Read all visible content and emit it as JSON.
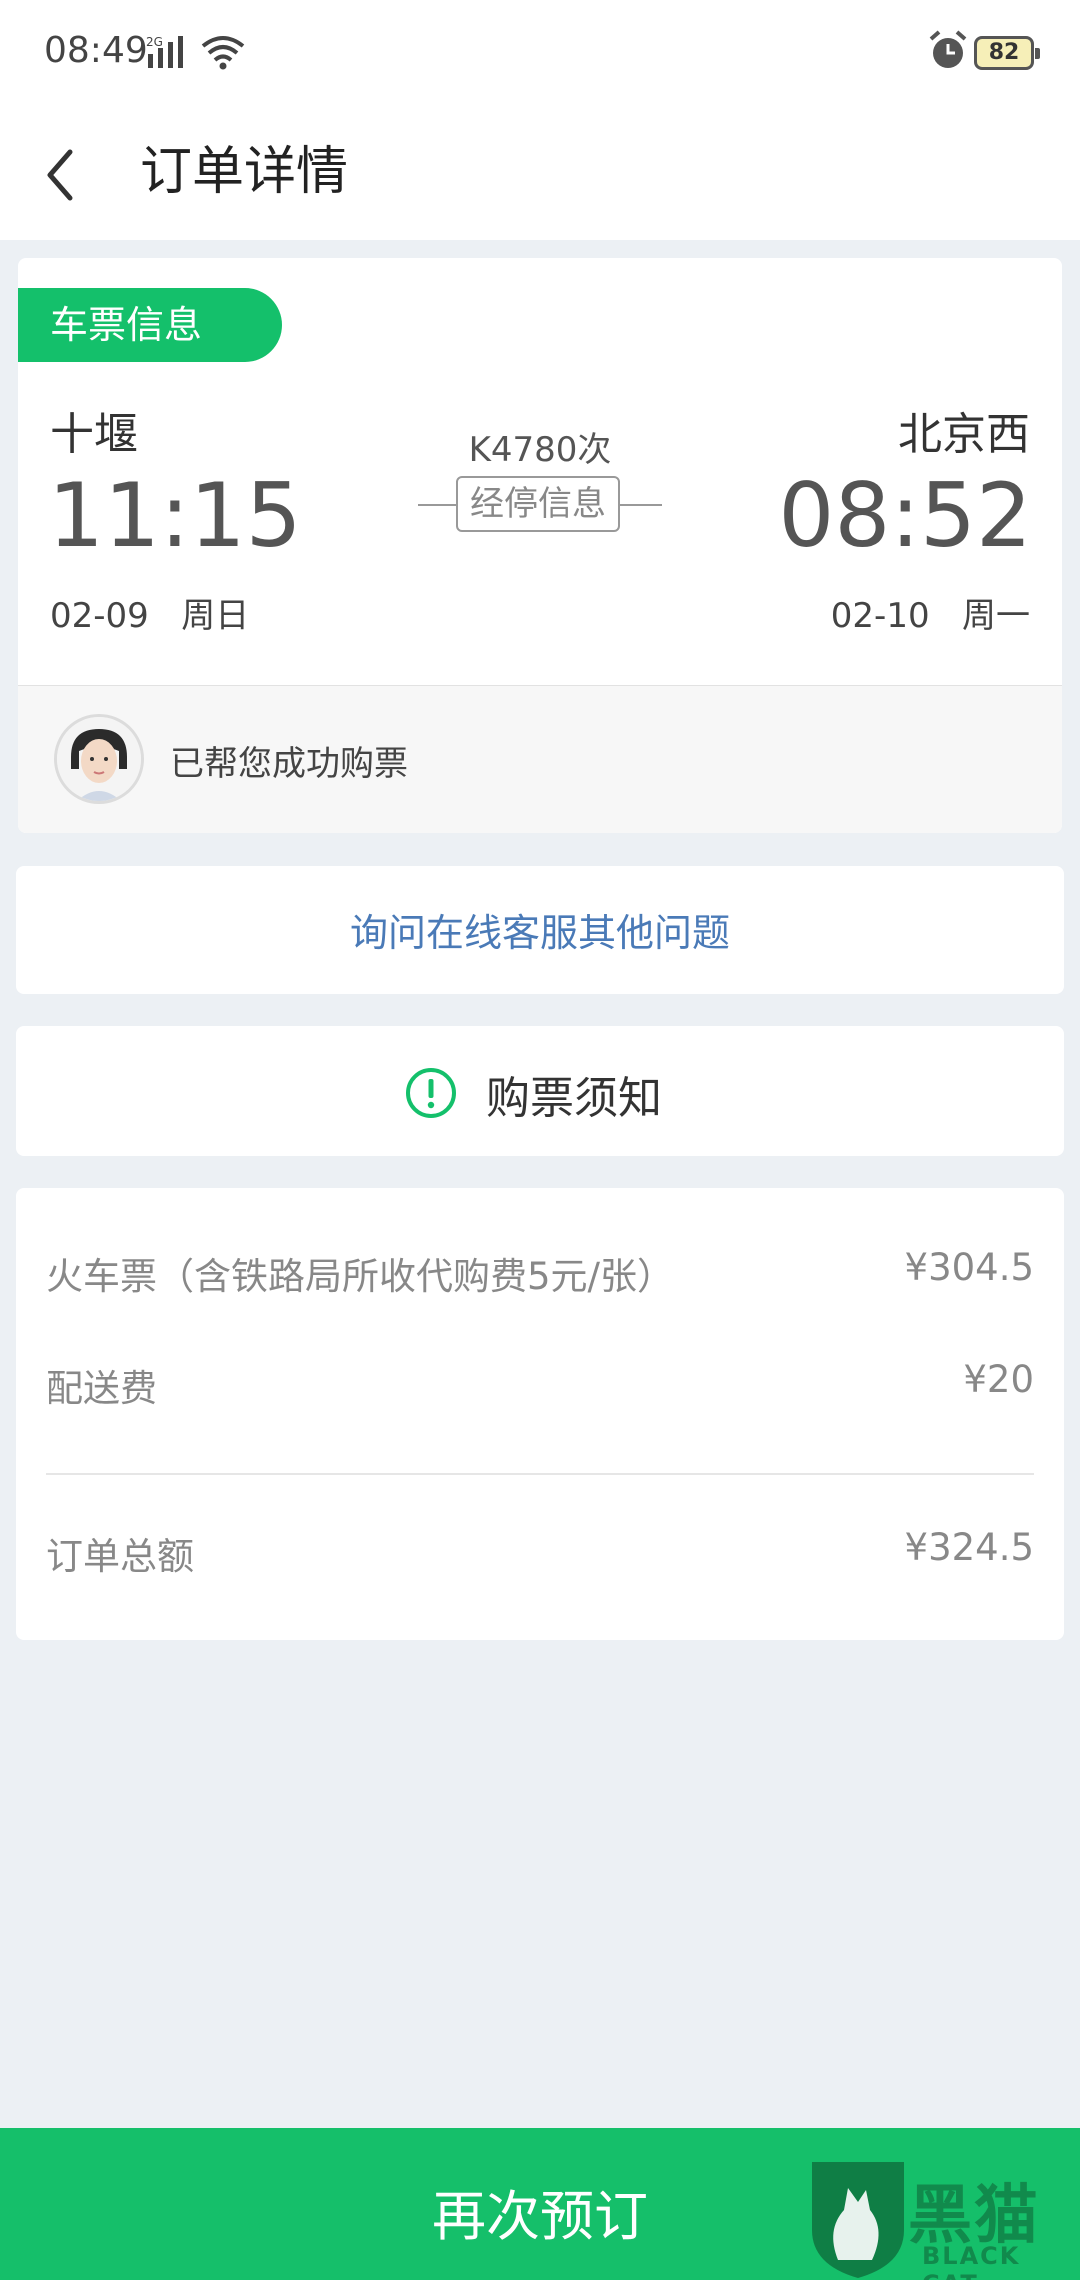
{
  "status_bar": {
    "time": "08:49",
    "network": "2G",
    "battery": "82"
  },
  "header": {
    "title": "订单详情"
  },
  "ticket": {
    "tag": "车票信息",
    "from_city": "十堰",
    "to_city": "北京西",
    "depart_time": "11:15",
    "arrive_time": "08:52",
    "depart_date": "02-09   周日",
    "arrive_date": "02-10   周一",
    "train_no": "K4780次",
    "stop_info": "经停信息",
    "agent_message": "已帮您成功购票"
  },
  "service": {
    "link_text": "询问在线客服其他问题"
  },
  "notice": {
    "label": "购票须知"
  },
  "prices": {
    "items": [
      {
        "label": "火车票（含铁路局所收代购费5元/张）",
        "value": "¥304.5"
      },
      {
        "label": "配送费",
        "value": "¥20"
      }
    ],
    "total_label": "订单总额",
    "total_value": "¥324.5"
  },
  "footer": {
    "rebook": "再次预订"
  },
  "watermark": {
    "cn": "黑猫",
    "en": "BLACK CAT"
  },
  "colors": {
    "accent": "#14c06b",
    "link": "#4a7ab7",
    "background": "#ecf0f4"
  }
}
